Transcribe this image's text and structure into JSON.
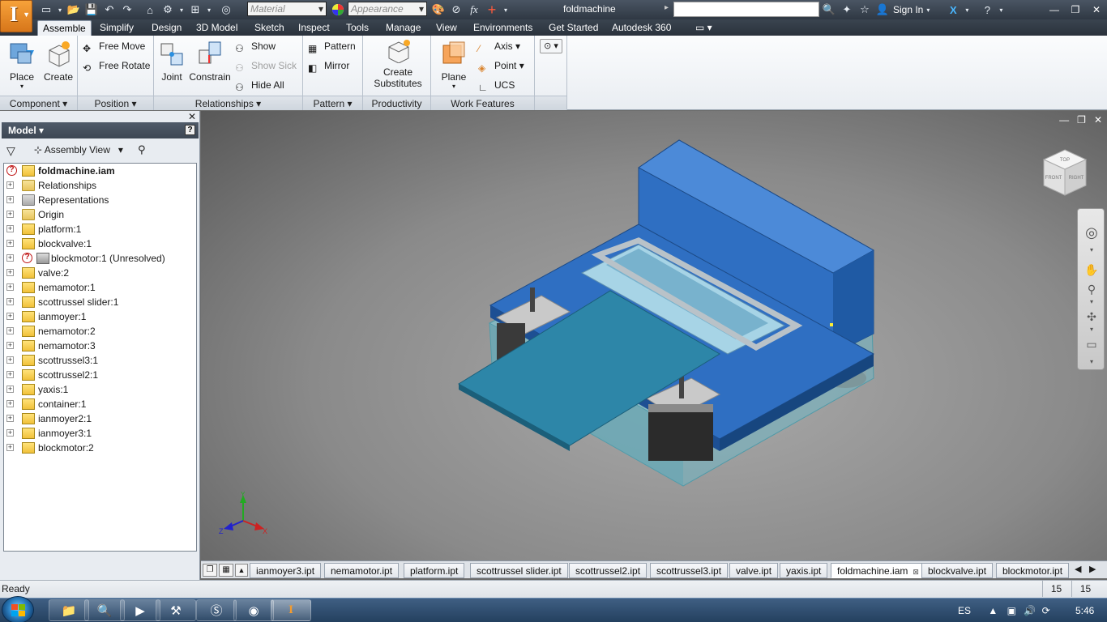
{
  "titlebar": {
    "document_title": "foldmachine",
    "material_placeholder": "Material",
    "appearance_placeholder": "Appearance",
    "sign_in": "Sign In",
    "fx_symbol": "fx"
  },
  "ribbon_tabs": [
    "Assemble",
    "Simplify",
    "Design",
    "3D Model",
    "Sketch",
    "Inspect",
    "Tools",
    "Manage",
    "View",
    "Environments",
    "Get Started",
    "Autodesk 360"
  ],
  "active_tab": "Assemble",
  "ribbon": {
    "component": {
      "title": "Component",
      "place": "Place",
      "create": "Create"
    },
    "position": {
      "title": "Position",
      "free_move": "Free Move",
      "free_rotate": "Free Rotate"
    },
    "relationships": {
      "title": "Relationships",
      "joint": "Joint",
      "constrain": "Constrain",
      "show": "Show",
      "show_sick": "Show Sick",
      "hide_all": "Hide All"
    },
    "pattern": {
      "title": "Pattern",
      "pattern": "Pattern",
      "mirror": "Mirror"
    },
    "productivity": {
      "title": "Productivity",
      "create": "Create",
      "substitutes": "Substitutes"
    },
    "work_features": {
      "title": "Work Features",
      "plane": "Plane",
      "axis": "Axis",
      "point": "Point",
      "ucs": "UCS"
    }
  },
  "browser": {
    "title": "Model",
    "view_label": "Assembly View",
    "root": "foldmachine.iam",
    "items": [
      {
        "label": "Relationships",
        "kind": "folder"
      },
      {
        "label": "Representations",
        "kind": "rep"
      },
      {
        "label": "Origin",
        "kind": "folder"
      },
      {
        "label": "platform:1",
        "kind": "part"
      },
      {
        "label": "blockvalve:1",
        "kind": "part"
      },
      {
        "label": "blockmotor:1 (Unresolved)",
        "kind": "unresolved"
      },
      {
        "label": "valve:2",
        "kind": "part"
      },
      {
        "label": "nemamotor:1",
        "kind": "part"
      },
      {
        "label": "scottrussel slider:1",
        "kind": "part"
      },
      {
        "label": "ianmoyer:1",
        "kind": "part"
      },
      {
        "label": "nemamotor:2",
        "kind": "part"
      },
      {
        "label": "nemamotor:3",
        "kind": "part"
      },
      {
        "label": "scottrussel3:1",
        "kind": "part"
      },
      {
        "label": "scottrussel2:1",
        "kind": "part"
      },
      {
        "label": "yaxis:1",
        "kind": "part"
      },
      {
        "label": "container:1",
        "kind": "part"
      },
      {
        "label": "ianmoyer2:1",
        "kind": "part"
      },
      {
        "label": "ianmoyer3:1",
        "kind": "part"
      },
      {
        "label": "blockmotor:2",
        "kind": "part"
      }
    ]
  },
  "viewcube": {
    "front": "FRONT",
    "right": "RIGHT",
    "top": "TOP"
  },
  "triad": {
    "x": "X",
    "y": "Y",
    "z": "Z"
  },
  "doc_tabs": [
    "ianmoyer3.ipt",
    "nemamotor.ipt",
    "platform.ipt",
    "scottrussel slider.ipt",
    "scottrussel2.ipt",
    "scottrussel3.ipt",
    "valve.ipt",
    "yaxis.ipt",
    "foldmachine.iam",
    "blockvalve.ipt",
    "blockmotor.ipt"
  ],
  "active_doc_tab": "foldmachine.iam",
  "status": {
    "text": "Ready",
    "count_a": "15",
    "count_b": "15"
  },
  "taskbar": {
    "language": "ES",
    "time": "5:46 AM"
  },
  "colors": {
    "accent": "#f39b2f",
    "ribbon_bg": "#e9edf2",
    "titlebar": "#2f3843",
    "viewport_top": "#585858",
    "model_blue": "#2f6fc2"
  }
}
